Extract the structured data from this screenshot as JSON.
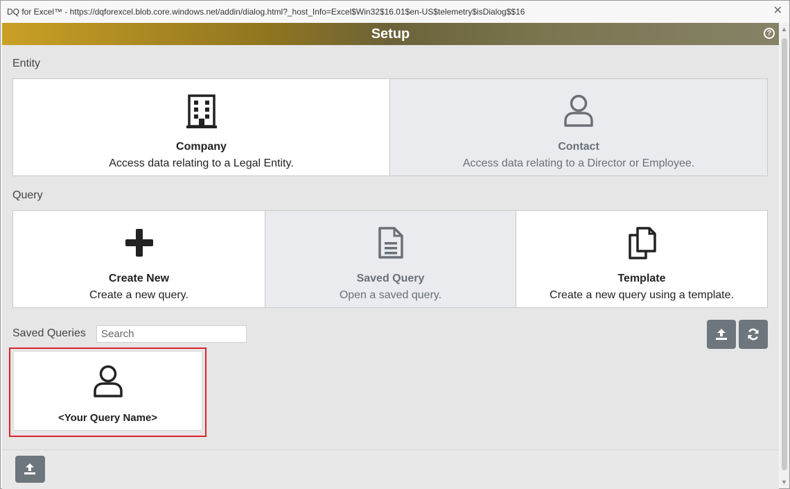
{
  "window": {
    "titlebar_text": "DQ for Excel™ - https://dqforexcel.blob.core.windows.net/addin/dialog.html?_host_Info=Excel$Win32$16.01$en-US$telemetry$isDialog$$16",
    "close_glyph": "✕"
  },
  "header": {
    "title": "Setup",
    "help_glyph": "?"
  },
  "entity": {
    "label": "Entity",
    "company": {
      "title": "Company",
      "desc": "Access data relating to a Legal Entity."
    },
    "contact": {
      "title": "Contact",
      "desc": "Access data relating to a Director or Employee."
    }
  },
  "query": {
    "label": "Query",
    "create_new": {
      "title": "Create New",
      "desc": "Create a new query."
    },
    "saved_query": {
      "title": "Saved Query",
      "desc": "Open a saved query."
    },
    "template": {
      "title": "Template",
      "desc": "Create a new query using a template."
    }
  },
  "saved_queries": {
    "label": "Saved Queries",
    "search_placeholder": "Search",
    "items": [
      {
        "name": "<Your Query Name>",
        "icon": "user-icon"
      }
    ]
  },
  "icons": {
    "building": "building-icon",
    "user": "user-icon",
    "plus": "plus-icon",
    "document": "document-icon",
    "copy": "copy-icon",
    "upload": "upload-icon",
    "refresh": "refresh-icon"
  },
  "colors": {
    "header_gold": "#caa025",
    "button_gray": "#6e767d",
    "highlight_red": "#d9242b",
    "disabled_card": "#e9ebee"
  }
}
